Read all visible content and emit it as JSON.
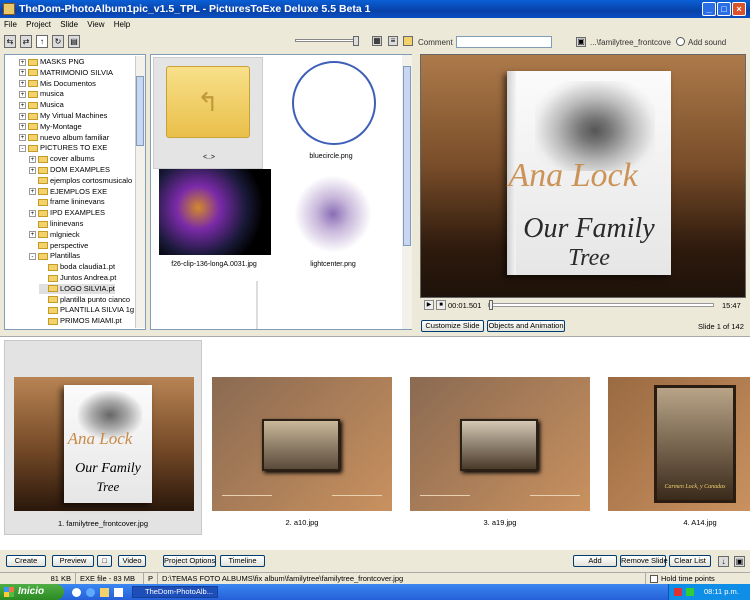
{
  "window": {
    "title": "TheDom-PhotoAlbum1pic_v1.5_TPL - PicturesToExe Deluxe 5.5 Beta 1"
  },
  "menu": [
    "File",
    "Project",
    "Slide",
    "View",
    "Help"
  ],
  "toolbar": {
    "comment_label": "Comment",
    "comment_value": "",
    "file_label": "...\\familytree_frontcove",
    "add_sound": "Add sound"
  },
  "tree": {
    "items": [
      {
        "label": "MASKS PNG",
        "indent": 1,
        "expander": "+"
      },
      {
        "label": "MATRIMONIO SILVIA",
        "indent": 1,
        "expander": "+"
      },
      {
        "label": "Mis Documentos",
        "indent": 1,
        "expander": "+"
      },
      {
        "label": "musica",
        "indent": 1,
        "expander": "+"
      },
      {
        "label": "Musica",
        "indent": 1,
        "expander": "+"
      },
      {
        "label": "My Virtual Machines",
        "indent": 1,
        "expander": "+"
      },
      {
        "label": "My-Montage",
        "indent": 1,
        "expander": "+"
      },
      {
        "label": "nuevo album familiar",
        "indent": 1,
        "expander": "+"
      },
      {
        "label": "PICTURES TO EXE",
        "indent": 1,
        "expander": "-"
      },
      {
        "label": "cover albums",
        "indent": 2,
        "expander": "+"
      },
      {
        "label": "DOM EXAMPLES",
        "indent": 2,
        "expander": "+"
      },
      {
        "label": "ejemplos cortosmusicalo",
        "indent": 2,
        "expander": ""
      },
      {
        "label": "EJEMPLOS EXE",
        "indent": 2,
        "expander": "+"
      },
      {
        "label": "frame lininevans",
        "indent": 2,
        "expander": ""
      },
      {
        "label": "IPD EXAMPLES",
        "indent": 2,
        "expander": "+"
      },
      {
        "label": "lininevans",
        "indent": 2,
        "expander": ""
      },
      {
        "label": "mlgnieck",
        "indent": 2,
        "expander": "+"
      },
      {
        "label": "perspective",
        "indent": 2,
        "expander": ""
      },
      {
        "label": "Plantillas",
        "indent": 2,
        "expander": "-"
      },
      {
        "label": "boda claudia1.pt",
        "indent": 3,
        "expander": ""
      },
      {
        "label": "Juntos Andrea.pt",
        "indent": 3,
        "expander": ""
      },
      {
        "label": "LOGO SILVIA.pt",
        "indent": 3,
        "expander": ""
      },
      {
        "label": "plantilla punto cianco",
        "indent": 3,
        "expander": ""
      },
      {
        "label": "PLANTILLA SILVIA 1g",
        "indent": 3,
        "expander": ""
      },
      {
        "label": "PRIMOS MIAMI.pt",
        "indent": 3,
        "expander": ""
      }
    ]
  },
  "files": [
    {
      "name": "<..>",
      "kind": "parent-folder"
    },
    {
      "name": "bluecircle.png",
      "kind": "circle"
    },
    {
      "name": "f26-clip-136-longA.0031.jpg",
      "kind": "fractal"
    },
    {
      "name": "lightcenter.png",
      "kind": "glow"
    }
  ],
  "preview": {
    "title_script": "Our Family",
    "title_script2": "Tree",
    "name_overlay": "Ana Lock",
    "time_current": "00:01.501",
    "time_total": "15:47"
  },
  "controls": {
    "customize": "Customize Slide",
    "objects": "Objects and Animation",
    "slide_of": "Slide 1 of 142"
  },
  "slides": [
    {
      "caption": "1. familytree_frontcover.jpg"
    },
    {
      "caption": "2. a10.jpg"
    },
    {
      "caption": "3. a19.jpg"
    },
    {
      "caption": "4. A14.jpg"
    }
  ],
  "bottom": {
    "create": "Create",
    "preview": "Preview",
    "video": "Video",
    "options": "Project Options",
    "timeline": "Timeline",
    "add": "Add",
    "remove": "Remove Slide",
    "clear": "Clear List"
  },
  "status": {
    "size": "81 KB",
    "type": "EXE file - 83 MB",
    "p": "P",
    "path": "D:\\TEMAS FOTO ALBUMS\\fix album\\familytree\\familytree_frontcover.jpg",
    "hold": "Hold time points"
  },
  "taskbar": {
    "start": "Inicio",
    "task": "TheDom-PhotoAlb...",
    "clock": "08:11 p.m.",
    "photo_caption": "Carmen Lock, y Canadas"
  }
}
